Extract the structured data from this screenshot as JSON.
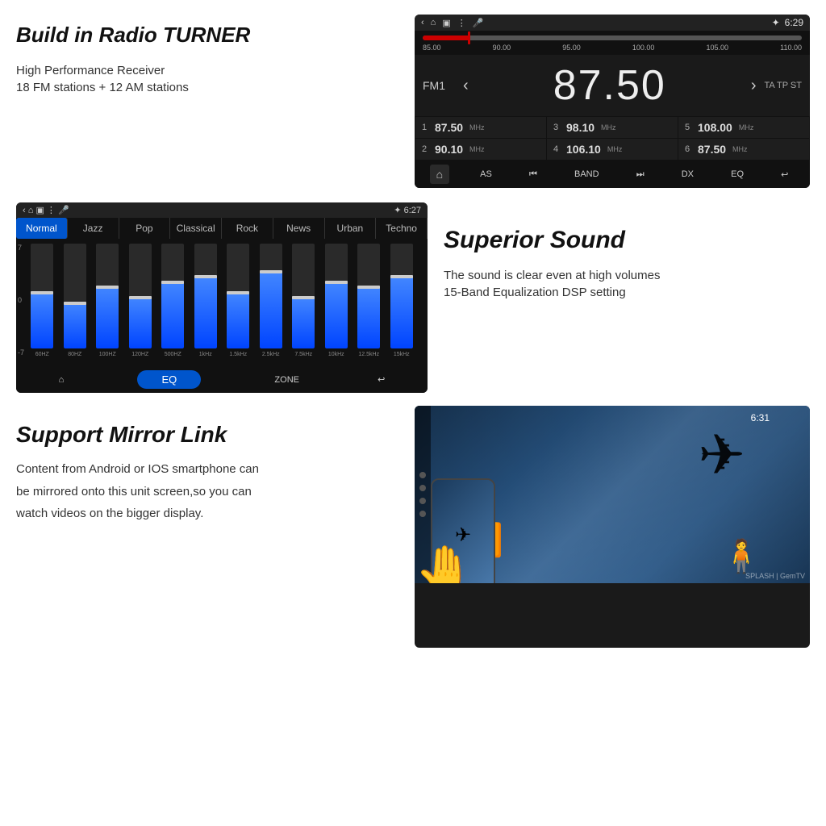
{
  "top": {
    "title": "Build in Radio TURNER",
    "desc1": "High Performance Receiver",
    "desc2": "18 FM stations + 12 AM stations",
    "radio": {
      "statusbar": {
        "time": "6:29",
        "bluetooth": "✦"
      },
      "freq_labels": [
        "85.00",
        "90.00",
        "95.00",
        "100.00",
        "105.00",
        "110.00"
      ],
      "band": "FM1",
      "frequency": "87.50",
      "ta_tp_st": "TA TP ST",
      "presets": [
        {
          "num": "1",
          "freq": "87.50",
          "unit": "MHz"
        },
        {
          "num": "3",
          "freq": "98.10",
          "unit": "MHz"
        },
        {
          "num": "5",
          "freq": "108.00",
          "unit": "MHz"
        },
        {
          "num": "2",
          "freq": "90.10",
          "unit": "MHz"
        },
        {
          "num": "4",
          "freq": "106.10",
          "unit": "MHz"
        },
        {
          "num": "6",
          "freq": "87.50",
          "unit": "MHz"
        }
      ],
      "controls": [
        "AS",
        "⏮",
        "BAND",
        "⏭",
        "DX",
        "EQ",
        "↩"
      ]
    }
  },
  "middle": {
    "eq": {
      "statusbar_time": "6:27",
      "modes": [
        "Normal",
        "Jazz",
        "Pop",
        "Classical",
        "Rock",
        "News",
        "Urban",
        "Techno"
      ],
      "active_mode": "Normal",
      "level_labels": [
        "7",
        "0",
        "-7"
      ],
      "bars": [
        {
          "label": "60HZ",
          "height_pct": 55,
          "thumb_pct": 55
        },
        {
          "label": "80HZ",
          "height_pct": 45,
          "thumb_pct": 45
        },
        {
          "label": "100HZ",
          "height_pct": 60,
          "thumb_pct": 60
        },
        {
          "label": "120HZ",
          "height_pct": 50,
          "thumb_pct": 50
        },
        {
          "label": "500HZ",
          "height_pct": 65,
          "thumb_pct": 65
        },
        {
          "label": "1kHz",
          "height_pct": 70,
          "thumb_pct": 70
        },
        {
          "label": "1.5kHz",
          "height_pct": 55,
          "thumb_pct": 55
        },
        {
          "label": "2.5kHz",
          "height_pct": 75,
          "thumb_pct": 75
        },
        {
          "label": "7.5kHz",
          "height_pct": 50,
          "thumb_pct": 50
        },
        {
          "label": "10kHz",
          "height_pct": 65,
          "thumb_pct": 65
        },
        {
          "label": "12.5kHz",
          "height_pct": 60,
          "thumb_pct": 60
        },
        {
          "label": "15kHz",
          "height_pct": 70,
          "thumb_pct": 70
        }
      ],
      "bottom_controls": [
        "🏠",
        "EQ",
        "ZONE",
        "↩"
      ]
    },
    "title": "Superior Sound",
    "desc1": "The sound is clear even at high volumes",
    "desc2": "15-Band Equalization DSP setting"
  },
  "bottom": {
    "title": "Support Mirror Link",
    "desc1": "Content from Android or IOS smartphone can",
    "desc2": "be mirrored onto this unit screen,so you can",
    "desc3": "watch videos on the  bigger display.",
    "mirror": {
      "time": "6:31",
      "watermark": "SPLASH | GemTV"
    }
  }
}
